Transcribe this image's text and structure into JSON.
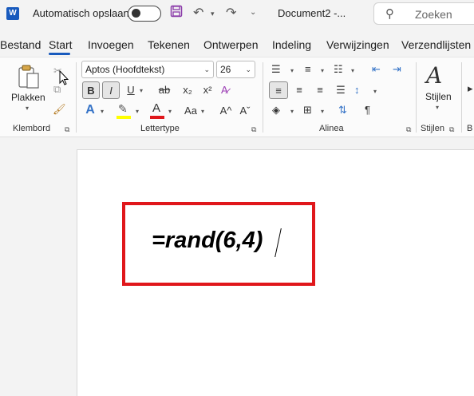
{
  "titlebar": {
    "app_logo": "W",
    "autosave_label": "Automatisch opslaan",
    "autosave_state": "off",
    "doc_title": "Document2  -...",
    "search_placeholder": "Zoeken"
  },
  "tabs": [
    {
      "label": "Bestand"
    },
    {
      "label": "Start",
      "active": true
    },
    {
      "label": "Invoegen"
    },
    {
      "label": "Tekenen"
    },
    {
      "label": "Ontwerpen"
    },
    {
      "label": "Indeling"
    },
    {
      "label": "Verwijzingen"
    },
    {
      "label": "Verzendlijsten"
    }
  ],
  "ribbon": {
    "clipboard": {
      "paste_label": "Plakken",
      "group_label": "Klembord"
    },
    "font": {
      "font_name": "Aptos (Hoofdtekst)",
      "font_size": "26",
      "group_label": "Lettertype",
      "bold": "B",
      "italic": "I",
      "underline": "U",
      "strike": "ab",
      "subscript": "x₂",
      "superscript": "x²",
      "text_effects": "A",
      "highlight_color": "#ffff00",
      "font_color": "#e0171b",
      "case": "Aa",
      "grow": "A^",
      "shrink": "Aˇ"
    },
    "paragraph": {
      "group_label": "Alinea",
      "pilcrow": "¶"
    },
    "styles": {
      "label": "Stijlen",
      "group_label": "Stijlen"
    }
  },
  "document": {
    "text": "=rand(6,4)",
    "highlight_box_color": "#e0171b"
  }
}
